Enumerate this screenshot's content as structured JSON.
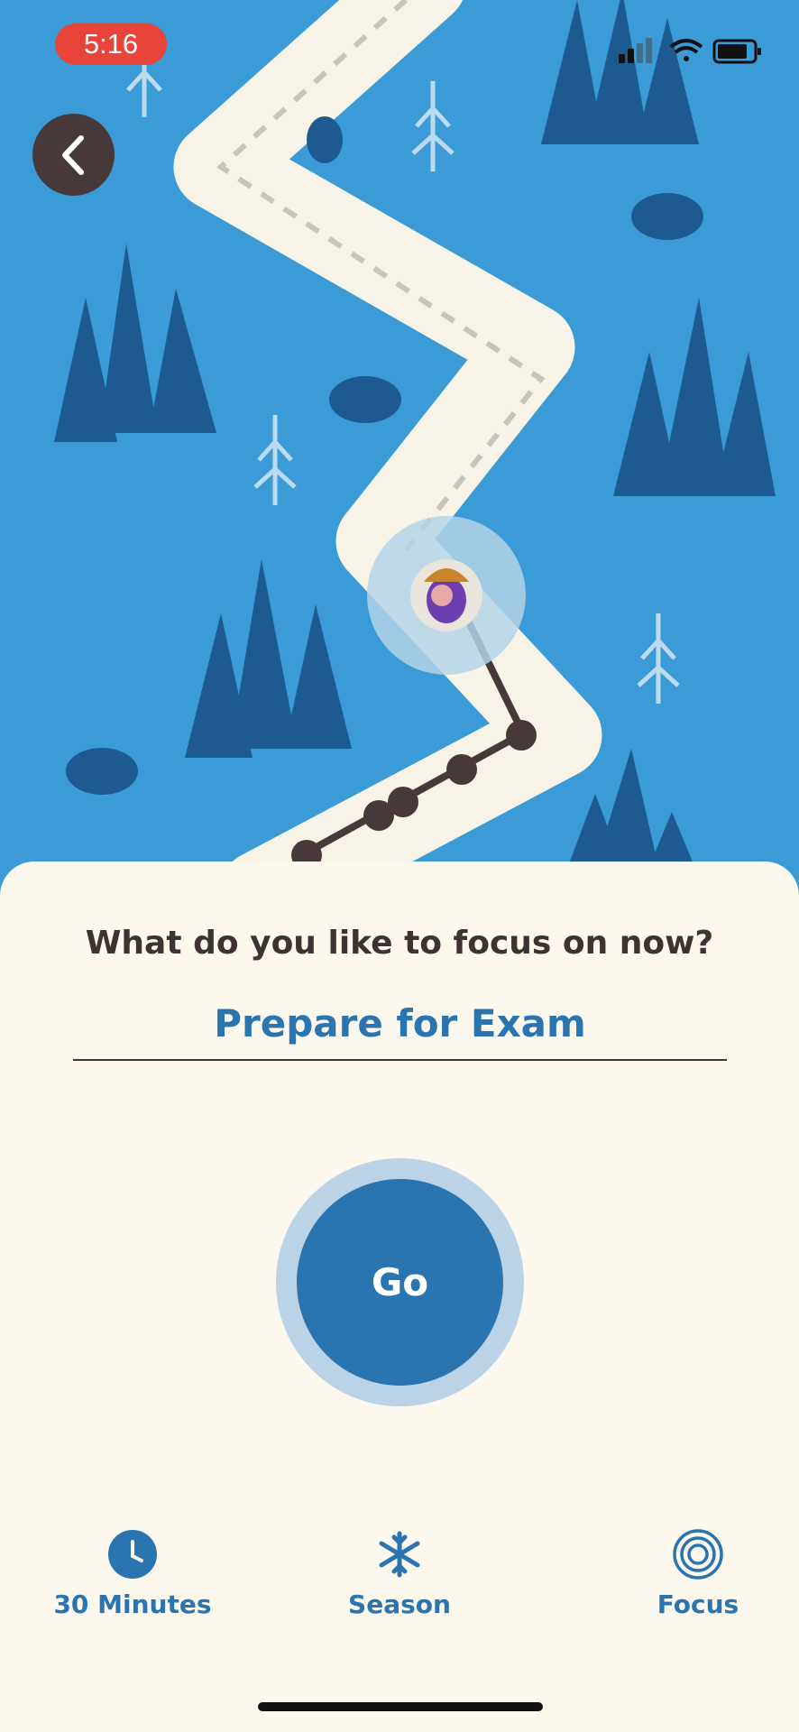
{
  "status_bar": {
    "time": "5:16"
  },
  "colors": {
    "accent": "#2a74b0",
    "map_bg": "#3a9bd6",
    "sheet_bg": "#fcf8ee",
    "text_dark": "#3e3232"
  },
  "header": {
    "back_icon": "chevron-left-icon"
  },
  "focus_prompt": {
    "question": "What do you like to focus on now?",
    "task_value": "Prepare for Exam"
  },
  "start": {
    "label": "Go"
  },
  "options": [
    {
      "icon": "clock-icon",
      "label": "30 Minutes"
    },
    {
      "icon": "snowflake-icon",
      "label": "Season"
    },
    {
      "icon": "focus-target-icon",
      "label": "Focus"
    }
  ]
}
